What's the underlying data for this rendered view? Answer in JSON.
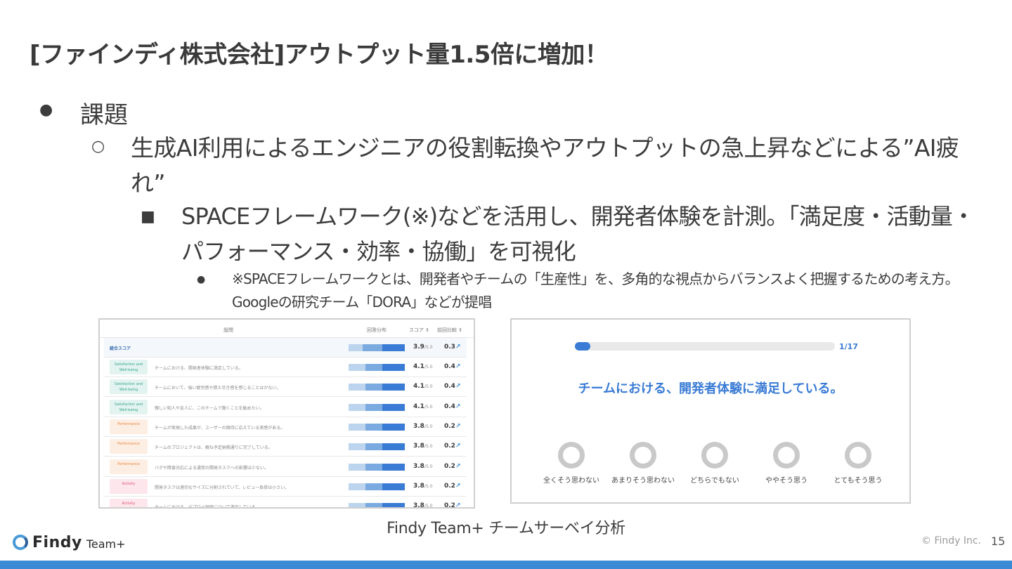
{
  "slide": {
    "title": "[ファインディ株式会社]アウトプット量1.5倍に増加！",
    "bullet_l1": "課題",
    "bullet_l2": "生成AI利用によるエンジニアの役割転換やアウトプットの急上昇などによる”AI疲れ”",
    "bullet_l3": "SPACEフレームワーク(※)などを活用し、開発者体験を計測。「満足度・活動量・パフォーマンス・効率・協働」を可視化",
    "bullet_l4": "※SPACEフレームワークとは、開発者やチームの「生産性」を、多角的な視点からバランスよく把握するための考え方。Googleの研究チーム「DORA」などが提唱",
    "markers": {
      "l1": "●",
      "l2": "○",
      "l3": "■",
      "l4": "●"
    },
    "caption": "Findy Team+ チームサーベイ分析",
    "copyright": "© Findy Inc.",
    "page_number": "15",
    "brand": "Findy",
    "brand_sub": "Team+",
    "accent_color": "#3a8ad6"
  },
  "table": {
    "headers": {
      "question": "設問",
      "distribution": "回答分布",
      "score": "スコア ⇕",
      "diff": "前回比較 ⇕"
    },
    "total_label": "総合スコア",
    "total_score": "3.9",
    "total_diff": "0.3",
    "score_suffix": "/5.0",
    "trend_icon": "↗",
    "rows": [
      {
        "category": "Satisfaction and Well-being",
        "question": "チームにおける、開発者体験に満足している。",
        "score": "4.1",
        "diff": "0.4"
      },
      {
        "category": "Satisfaction and Well-being",
        "question": "チームにおいて、強い疲労感や燃え尽き感を感じることはかない。",
        "score": "4.1",
        "diff": "0.4"
      },
      {
        "category": "Satisfaction and Well-being",
        "question": "親しい知人や友人に、このチームで働くことを勧めたい。",
        "score": "4.1",
        "diff": "0.4"
      },
      {
        "category": "Performance",
        "question": "チームが実現した成果が、ユーザーの期待に応えている実感がある。",
        "score": "3.8",
        "diff": "0.2"
      },
      {
        "category": "Performance",
        "question": "チームのプロジェクトは、概ね予定納期通りに完了している。",
        "score": "3.8",
        "diff": "0.2"
      },
      {
        "category": "Performance",
        "question": "バグや障害対応による通常の開発タスクへの影響は少ない。",
        "score": "3.8",
        "diff": "0.2"
      },
      {
        "category": "Activity",
        "question": "開発タスクは適切なサイズに分割されていて、レビュー負荷は小さい。",
        "score": "3.8",
        "diff": "0.2"
      },
      {
        "category": "Activity",
        "question": "チームにおける、デプロイ頻度について満足している。",
        "score": "3.8",
        "diff": "0.2"
      }
    ]
  },
  "survey": {
    "progress_label": "1/17",
    "progress_fraction": 0.059,
    "question": "チームにおける、開発者体験に満足している。",
    "options": [
      "全くそう思わない",
      "あまりそう思わない",
      "どちらでもない",
      "ややそう思う",
      "とてもそう思う"
    ]
  }
}
